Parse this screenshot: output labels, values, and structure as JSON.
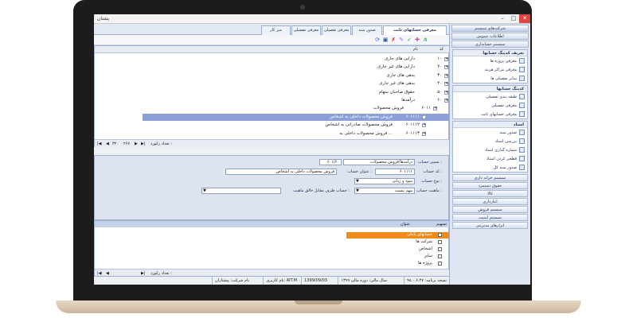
{
  "window": {
    "title": "پشتان"
  },
  "tabs": [
    {
      "label": "معرفی حسابهای ثابت"
    },
    {
      "label": "صدور سند"
    },
    {
      "label": "معرفی تفصیلی"
    },
    {
      "label": "معرفی تفصیلی"
    },
    {
      "label": "میز کار"
    }
  ],
  "tree": {
    "header_code": "کد",
    "header_name": "نام",
    "rows": [
      {
        "code": "۱۰",
        "name": "دارایی های جاری"
      },
      {
        "code": "۲۰",
        "name": "دارایی های غیر جاری"
      },
      {
        "code": "۳۰",
        "name": "بدهی های جاری"
      },
      {
        "code": "۴۰",
        "name": "بدهی های غیر جاری"
      },
      {
        "code": "۵۰",
        "name": "حقوق صاحبان سهام"
      },
      {
        "code": "۶۰",
        "name": "درآمدها"
      },
      {
        "code": "۶۰۱۱",
        "name": "فروش محصولات"
      },
      {
        "code": "۶۰۱۱۱۱",
        "name": "فروش محصولات داخلی به اشخاص"
      },
      {
        "code": "۶۰۱۱۱۲",
        "name": "فروش محصولات صادراتی به اشخاص"
      },
      {
        "code": "۶۰۱۱۱۳",
        "name": "فروش محصولات داخلی به ..."
      }
    ],
    "pager": {
      "count_label": "تعداد رکورد :",
      "current": "۳۲۰",
      "total": "۲۶۷"
    }
  },
  "form": {
    "path_label": "مسیر حساب :",
    "path_value": "درآمدها/فروش محصولات",
    "path_code": "۶۰۱/۶۰",
    "code_label": "کد حساب :",
    "code_value": "۶۰۱۱۱۱",
    "title_label": "عنوان حساب :",
    "title_value": "فروش محصولات داخلی به اشخاص",
    "type_label": "نوع حساب :",
    "type_value": "سود و زیانی",
    "nature_label": "ماهیت حساب :",
    "nature_value": "مهم نیست",
    "opposite_label": "حساب طرف مقابل خالق ماهیت :"
  },
  "lower": {
    "tab_label": "تسهیم",
    "column_title": "عنوان",
    "rows": [
      {
        "name": "حسابهای بانکی",
        "highlight": true
      },
      {
        "name": "شرکت ها",
        "highlight": false
      },
      {
        "name": "اشخاص",
        "highlight": false
      },
      {
        "name": "سایر",
        "highlight": false
      },
      {
        "name": "پروژه ها",
        "highlight": false
      }
    ],
    "count_label": "تعداد رکورد :"
  },
  "status": {
    "version": "نسخه برنامه: ۹۸.۰.۶.۲۷",
    "fiscal": "سال مالی: دوره مالی ۱۳۹۹",
    "date": "1399/09/03",
    "user": "نام کاربری: AIT.M",
    "company": "نام شرکت: پیشتازان"
  },
  "rightnav": {
    "top_items": [
      "شرکت‌های سیستم",
      "اطلاعات عمومی",
      "سیستم حسابداری"
    ],
    "panel1": {
      "title": "تعریف کدینگ حسابها",
      "items": [
        "معرفی پروژه ها",
        "معرفی مراکز هزینه",
        "سایر تفصیلی ها"
      ]
    },
    "panel2": {
      "title": "کدینگ حسابها",
      "items": [
        "طبقه بندی تفصیلی",
        "معرفی تفصیلی",
        "معرفی حسابهای ثابت"
      ]
    },
    "panel3": {
      "title": "اسناد",
      "items": [
        "صدور سند",
        "بررسی اسناد",
        "شماره گذاری اسناد",
        "قطعی کردن اسناد",
        "صدور سند کل"
      ]
    },
    "bottom_items": [
      "سیستم خزانه داری",
      "حقوق دستمزد",
      "کالا",
      "انبارداری",
      "سیستم فروش",
      "سیستم امنیت",
      "ابزارهای مدیریتی"
    ]
  }
}
